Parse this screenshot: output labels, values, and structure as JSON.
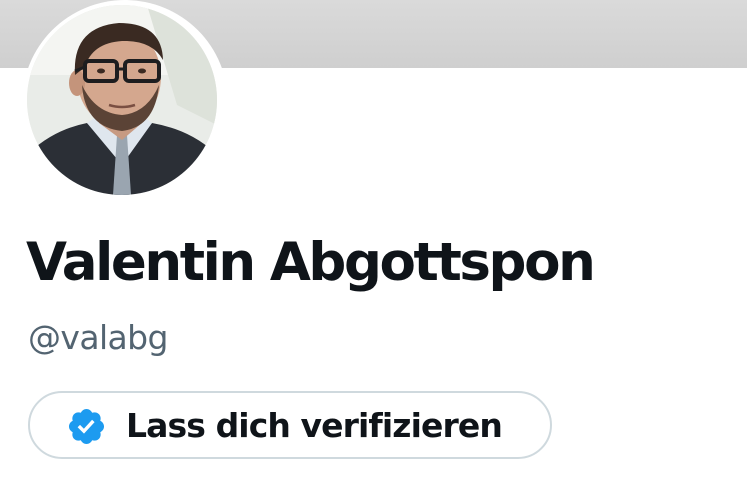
{
  "profile": {
    "display_name": "Valentin Abgottspon",
    "handle": "@valabg",
    "avatar": {
      "icon": "profile-photo",
      "alt": "Valentin Abgottspon"
    },
    "verify_button": {
      "label": "Lass dich verifizieren",
      "icon": "verified-badge-icon"
    }
  },
  "colors": {
    "text_primary": "#0f1419",
    "text_secondary": "#536471",
    "border": "#cfd9de",
    "verified_blue": "#1d9bf0",
    "banner": "#d6d6d6"
  }
}
